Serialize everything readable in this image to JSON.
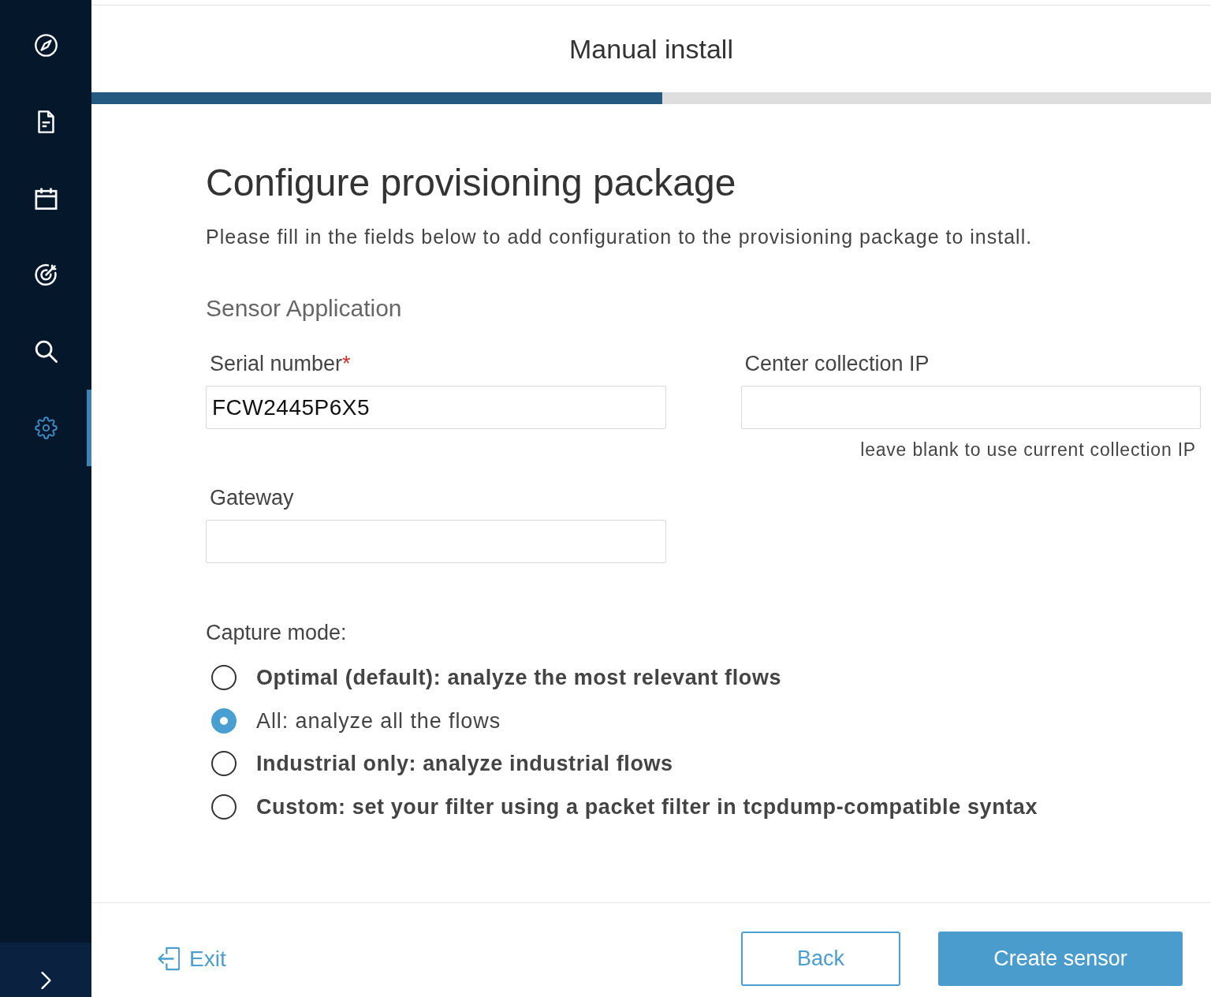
{
  "sidebar": {
    "items": [
      {
        "selected": false
      },
      {
        "selected": false
      },
      {
        "selected": false
      },
      {
        "selected": false
      },
      {
        "selected": false
      },
      {
        "selected": true
      }
    ]
  },
  "header": {
    "title": "Manual install",
    "progress": {
      "level": 0.51
    }
  },
  "form": {
    "title": "Configure provisioning package",
    "description": "Please fill in the fields below to add configuration to the provisioning package to install.",
    "section": "Sensor Application",
    "fields": [
      {
        "label": "Serial number",
        "required_mark": "*",
        "value": "FCW2445P6X5"
      },
      {
        "label": "Center collection IP",
        "hint": "leave blank to use current collection IP"
      },
      {
        "label": "Gateway"
      }
    ]
  },
  "capture_mode": {
    "label": "Capture mode:",
    "options": [
      {
        "label": "Optimal (default): analyze the most relevant flows",
        "selected": false
      },
      {
        "label": "All: analyze all the flows",
        "selected": true
      },
      {
        "label": "Industrial only: analyze industrial flows",
        "selected": false
      },
      {
        "label": "Custom: set your filter using a packet filter in tcpdump-compatible syntax",
        "selected": false
      }
    ]
  },
  "footer": {
    "exit": "Exit",
    "buttons": [
      {
        "label": "Back",
        "kind": "secondary"
      },
      {
        "label": "Create sensor",
        "kind": "primary"
      }
    ]
  }
}
